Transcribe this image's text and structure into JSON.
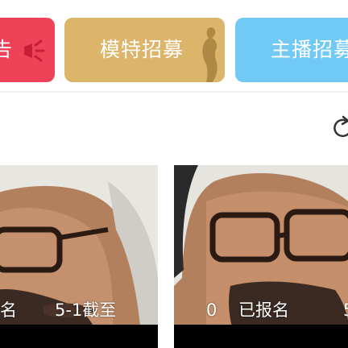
{
  "banners": {
    "ad": {
      "label": "告",
      "color": "#ef4157",
      "icon": "megaphone-icon"
    },
    "model": {
      "label": "模特招募",
      "color": "#dcb56b",
      "icon": "silhouette-icon"
    },
    "host": {
      "label": "主播招募",
      "color": "#71c9f5"
    }
  },
  "refresh": {
    "icon": "refresh-icon"
  },
  "cards": [
    {
      "caption_left": "名",
      "caption_right": "5-1截至"
    },
    {
      "caption_left": "0",
      "caption_status": "已报名",
      "caption_right": "5"
    }
  ]
}
